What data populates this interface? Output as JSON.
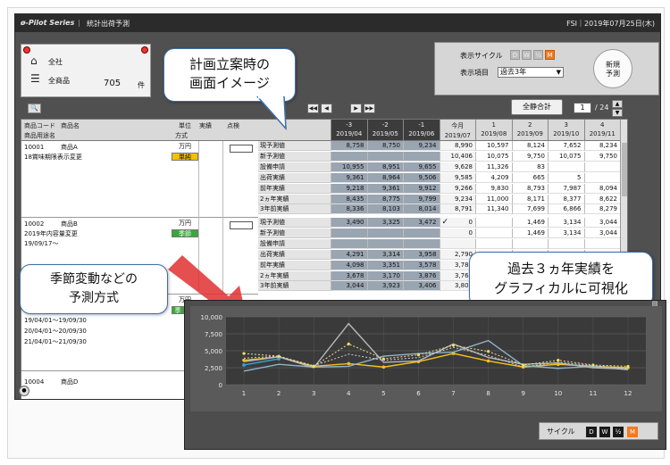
{
  "app": {
    "brand": "ø-Pilot Series",
    "title": "統計出荷予測",
    "right_info": "FSI｜2019年07月25日(木)",
    "win_controls": "▫ ✕"
  },
  "summary": {
    "company_label": "全社",
    "product_label": "全商品",
    "count": "705",
    "count_unit": "件"
  },
  "settings": {
    "cycle_label": "表示サイクル",
    "item_label": "表示項目",
    "cycles": [
      "D",
      "W",
      "½",
      "M"
    ],
    "selected_item": "過去3年",
    "new_forecast_line1": "新規",
    "new_forecast_line2": "予測"
  },
  "toolbar": {
    "search_icon": "🔍",
    "nav": [
      "◀◀",
      "◀",
      "▶",
      "▶▶"
    ],
    "total_button": "全静合計",
    "page": "1",
    "page_total": "/ 24",
    "up": "▲",
    "down": "▼"
  },
  "grid": {
    "headers": {
      "col1_line1": "商品コード",
      "col1_line1b": "商品名",
      "col1_line2": "商品用途名",
      "unit_line1": "単位",
      "unit_line2": "方式",
      "actual": "実績",
      "check": "点検"
    },
    "periods": [
      {
        "rel": "-3",
        "date": "2019/04"
      },
      {
        "rel": "-2",
        "date": "2019/05"
      },
      {
        "rel": "-1",
        "date": "2019/06"
      },
      {
        "rel": "今月",
        "date": "2019/07"
      },
      {
        "rel": "1",
        "date": "2019/08"
      },
      {
        "rel": "2",
        "date": "2019/09"
      },
      {
        "rel": "3",
        "date": "2019/10"
      },
      {
        "rel": "4",
        "date": "2019/11"
      }
    ],
    "products": [
      {
        "code": "10001",
        "name": "商品A",
        "usage": "18賞味期限表示変更",
        "unit": "万円",
        "method": "単純",
        "method_color": "yellow",
        "periods": "",
        "rows": [
          {
            "label": "現予測値",
            "values": [
              "8,758",
              "8,750",
              "9,234",
              "8,990",
              "10,597",
              "8,124",
              "7,652",
              "8,234"
            ]
          },
          {
            "label": "新予測値",
            "values": [
              "",
              "",
              "",
              "10,406",
              "10,075",
              "9,750",
              "10,075",
              "9,750"
            ]
          },
          {
            "label": "設備申請",
            "values": [
              "10,955",
              "8,951",
              "9,655",
              "9,628",
              "11,326",
              "83",
              "",
              ""
            ]
          },
          {
            "label": "出荷実績",
            "values": [
              "9,361",
              "8,964",
              "9,506",
              "9,585",
              "4,209",
              "665",
              "5",
              ""
            ]
          },
          {
            "label": "前年実績",
            "values": [
              "9,218",
              "9,361",
              "9,912",
              "9,266",
              "9,830",
              "8,793",
              "7,987",
              "8,094"
            ]
          },
          {
            "label": "2ヵ年実績",
            "values": [
              "8,435",
              "8,775",
              "9,799",
              "9,234",
              "11,000",
              "8,171",
              "8,377",
              "8,622"
            ]
          },
          {
            "label": "3年前実績",
            "values": [
              "8,336",
              "8,103",
              "8,014",
              "8,791",
              "11,340",
              "7,699",
              "6,866",
              "8,279"
            ]
          }
        ]
      },
      {
        "code": "10002",
        "name": "商品B",
        "usage": "2019年内容量変更",
        "period_note": "19/09/17〜",
        "unit": "万円",
        "method": "季節",
        "method_color": "green",
        "rows": [
          {
            "label": "現予測値",
            "values": [
              "3,490",
              "3,325",
              "3,472",
              "0",
              "",
              "1,469",
              "3,134",
              "3,044"
            ],
            "check": "✓"
          },
          {
            "label": "新予測値",
            "values": [
              "",
              "",
              "",
              "0",
              "",
              "1,469",
              "3,134",
              "3,044"
            ]
          },
          {
            "label": "設備申請",
            "values": [
              "",
              "",
              "",
              "",
              "",
              "",
              "",
              ""
            ]
          },
          {
            "label": "出荷実績",
            "values": [
              "4,291",
              "3,314",
              "3,958",
              "2,790",
              "",
              "",
              "",
              ""
            ]
          },
          {
            "label": "前年実績",
            "values": [
              "4,098",
              "3,351",
              "3,578",
              "3,781",
              "",
              "",
              "",
              ""
            ]
          },
          {
            "label": "2ヵ年実績",
            "values": [
              "3,678",
              "3,170",
              "3,876",
              "3,766",
              "",
              "",
              "",
              ""
            ]
          },
          {
            "label": "3年前実績",
            "values": [
              "3,044",
              "3,923",
              "3,406",
              "3,802",
              "",
              "",
              "",
              ""
            ]
          }
        ]
      },
      {
        "unit": "万円",
        "method_partial": "季",
        "date_lines": [
          "19/04/01〜19/09/30",
          "20/04/01〜20/09/30",
          "21/04/01〜21/09/30"
        ]
      },
      {
        "code_partial": "10004",
        "name_partial": "商品D"
      }
    ]
  },
  "callouts": {
    "planning": [
      "計画立案時の",
      "画面イメージ"
    ],
    "seasonal": [
      "季節変動などの",
      "予測方式"
    ],
    "visualize": [
      "過去３ヵ年実績を",
      "グラフィカルに可視化"
    ]
  },
  "chart_window": {
    "cycle_label": "サイクル",
    "cycles": [
      "D",
      "W",
      "½",
      "M"
    ]
  },
  "chart_data": {
    "type": "line",
    "x": [
      1,
      2,
      3,
      4,
      5,
      6,
      7,
      8,
      9,
      10,
      11,
      12
    ],
    "ylim": [
      0,
      10000
    ],
    "yticks": [
      "10,000",
      "7,500",
      "5,000",
      "2,500",
      "0"
    ],
    "grid": true,
    "series": [
      {
        "color": "#f5c218",
        "style": "solid",
        "values": [
          3600,
          4100,
          2700,
          3100,
          2600,
          3400,
          4600,
          3500,
          2600,
          3000,
          2700,
          2500
        ]
      },
      {
        "color": "#8fb3c7",
        "style": "solid",
        "values": [
          2000,
          3000,
          2600,
          2700,
          4200,
          4600,
          4800,
          6500,
          2800,
          2400,
          2700,
          2200
        ]
      },
      {
        "color": "#38a8d8",
        "style": "solid",
        "values": [
          2900,
          3800,
          null,
          null,
          null,
          null,
          null,
          null,
          null,
          null,
          null,
          null
        ]
      },
      {
        "color": "#b8b8b8",
        "style": "solid",
        "values": [
          3400,
          4100,
          2500,
          9000,
          3300,
          3500,
          6000,
          4000,
          3000,
          3200,
          2500,
          2300
        ]
      },
      {
        "color": "#f0e090",
        "style": "dotted",
        "values": [
          4600,
          4200,
          2700,
          6000,
          3800,
          4400,
          5800,
          4900,
          2900,
          3600,
          2900,
          2700
        ]
      },
      {
        "color": "#d0d0d0",
        "style": "dotted",
        "values": [
          3900,
          4200,
          2800,
          4500,
          3600,
          4000,
          5500,
          4300,
          2600,
          3300,
          2800,
          2400
        ]
      }
    ]
  }
}
